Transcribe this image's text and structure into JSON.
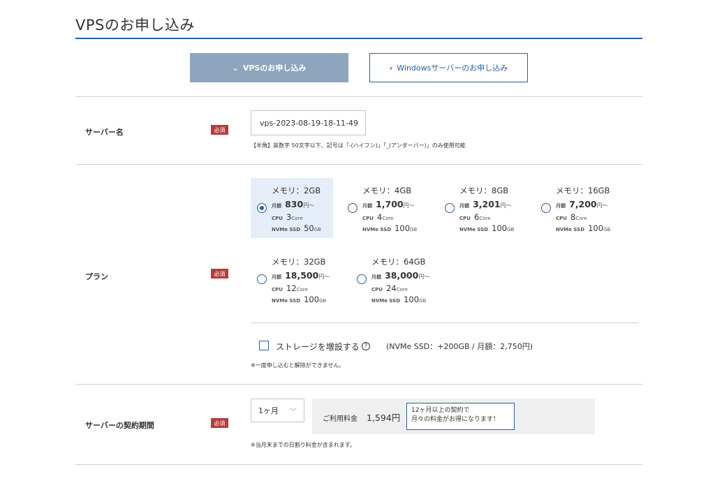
{
  "page": {
    "title": "VPSのお申し込み"
  },
  "tabs": {
    "vps": {
      "label": "VPSのお申し込み",
      "chevron": "⌄"
    },
    "windows": {
      "label": "Windowsサーバーのお申し込み",
      "chevron": "›"
    }
  },
  "server_name": {
    "label": "サーバー名",
    "required": "必須",
    "value": "vps-2023-08-19-18-11-49",
    "note": "【半角】英数字 50文字以下、記号は「-(ハイフン)」「_(アンダーバー)」のみ使用可能"
  },
  "plan": {
    "label": "プラン",
    "required": "必須",
    "monthly_label": "月額",
    "yen_unit": "円～",
    "cpu_label": "CPU",
    "core_unit": "Core",
    "ssd_label": "NVMe SSD",
    "gb_unit": "GB",
    "options": [
      {
        "memory": "メモリ：2GB",
        "price": "830",
        "cpu": "3",
        "ssd": "50",
        "selected": true
      },
      {
        "memory": "メモリ：4GB",
        "price": "1,700",
        "cpu": "4",
        "ssd": "100",
        "selected": false
      },
      {
        "memory": "メモリ：8GB",
        "price": "3,201",
        "cpu": "6",
        "ssd": "100",
        "selected": false
      },
      {
        "memory": "メモリ：16GB",
        "price": "7,200",
        "cpu": "8",
        "ssd": "100",
        "selected": false
      },
      {
        "memory": "メモリ：32GB",
        "price": "18,500",
        "cpu": "12",
        "ssd": "100",
        "selected": false
      },
      {
        "memory": "メモリ：64GB",
        "price": "38,000",
        "cpu": "24",
        "ssd": "100",
        "selected": false
      }
    ],
    "storage": {
      "label": "ストレージを増設する",
      "help_glyph": "?",
      "price": "(NVMe SSD：+200GB / 月額：2,750円)",
      "note": "※一度申し込むと解除ができません。",
      "checked": false
    }
  },
  "period": {
    "label": "サーバーの契約期間",
    "required": "必須",
    "selected": "1ヶ月",
    "caret": "﹀",
    "fee_label": "ご利用料金",
    "fee_value": "1,594円",
    "bubble_line1": "12ヶ月以上の契約で",
    "bubble_line2": "月々の料金がお得になります！",
    "note": "※当月末までの日割り料金が含まれます。"
  },
  "colors": {
    "accent": "#2a5d9f",
    "required": "#b83a3a",
    "tab_active": "#8fa5bd",
    "selected_plan": "#e5eef8"
  }
}
